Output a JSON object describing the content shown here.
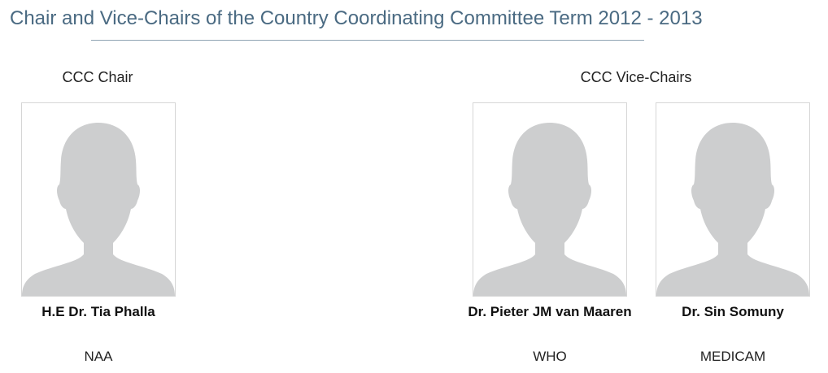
{
  "header": {
    "title": "Chair and Vice-Chairs of the Country Coordinating Committee Term 2012 - 2013"
  },
  "sections": {
    "chair_label": "CCC Chair",
    "vice_label": "CCC Vice-Chairs"
  },
  "people": [
    {
      "name": "H.E Dr. Tia Phalla",
      "org": "NAA",
      "photo_icon": "person-silhouette-icon"
    },
    {
      "name": "Dr. Pieter JM van Maaren",
      "org": "WHO",
      "photo_icon": "person-silhouette-icon"
    },
    {
      "name": "Dr. Sin Somuny",
      "org": "MEDICAM",
      "photo_icon": "person-silhouette-icon"
    }
  ],
  "colors": {
    "title": "#4a6a82",
    "rule": "#8fa3b2",
    "silhouette": "#cdcecf",
    "photo_border": "#d6d6d6"
  }
}
